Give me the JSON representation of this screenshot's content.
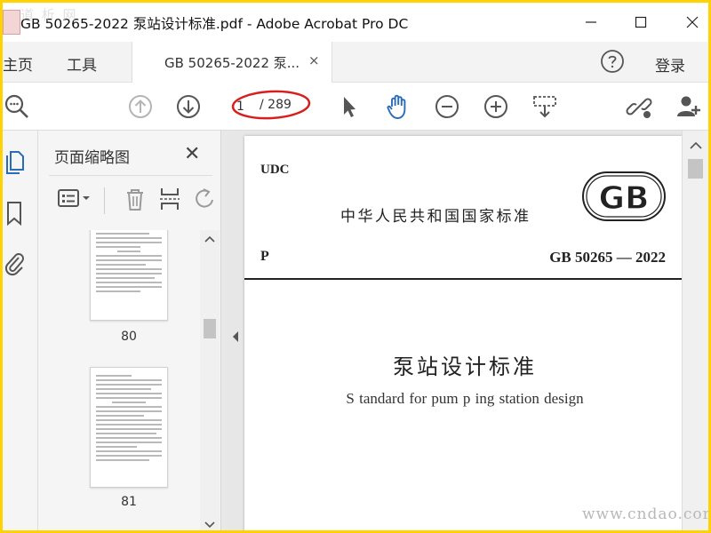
{
  "window": {
    "title": "GB 50265-2022 泵站设计标准.pdf - Adobe Acrobat Pro DC",
    "watermark_logo": "道 析 网"
  },
  "menu": {
    "home": "主页",
    "tools": "工具",
    "document_tab": "GB 50265-2022 泵...",
    "document_tab_close": "×",
    "sign_in": "登录"
  },
  "toolbar": {
    "current_page": "1",
    "total_pages": "/ 289",
    "icons": [
      "search-icon",
      "prev-page-icon",
      "next-page-icon",
      "select-cursor-icon",
      "hand-tool-icon",
      "zoom-out-icon",
      "zoom-in-icon",
      "marquee-zoom-icon",
      "share-link-icon",
      "add-user-icon"
    ]
  },
  "thumbnail_panel": {
    "title": "页面缩略图",
    "close": "✕",
    "thumbnails": [
      {
        "page_label": "80"
      },
      {
        "page_label": "81"
      }
    ]
  },
  "document": {
    "udc": "UDC",
    "national_standard": "中华人民共和国国家标准",
    "logo_text": "GB",
    "category": "P",
    "standard_number": "GB 50265 — 2022",
    "title_cn": "泵站设计标准",
    "title_en": "S tandard for pum p ing station design"
  },
  "site_watermark": "www.cndao.com",
  "colors": {
    "accent_blue": "#2b6cb8",
    "icon_gray": "#555555",
    "disabled_gray": "#b5b5b5",
    "annotation_red": "#d81f1f",
    "frame_yellow": "#ffd200"
  }
}
